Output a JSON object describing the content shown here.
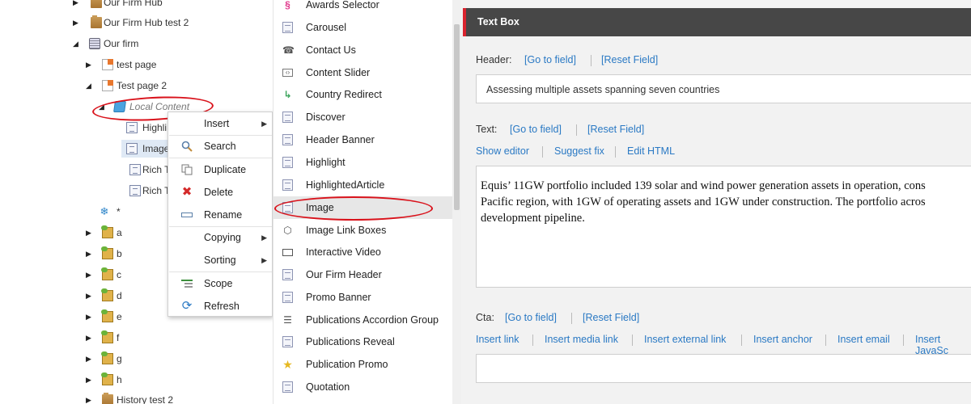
{
  "tree": {
    "nodes": [
      {
        "label": "Our Firm Hub",
        "icon": "folder-icon"
      },
      {
        "label": "Our Firm Hub test 2",
        "icon": "folder-icon"
      },
      {
        "label": "Our firm",
        "icon": "database-icon"
      },
      {
        "label": "test page",
        "icon": "page-icon"
      },
      {
        "label": "Test page 2",
        "icon": "page-icon"
      },
      {
        "label": "Local Content",
        "icon": "local-content-icon"
      },
      {
        "label": "Highli",
        "icon": "document-icon"
      },
      {
        "label": "Image",
        "icon": "document-icon"
      },
      {
        "label": "Rich T",
        "icon": "document-icon"
      },
      {
        "label": "Rich T",
        "icon": "document-icon"
      },
      {
        "label": "*",
        "icon": "snowflake-icon"
      },
      {
        "label": "a",
        "icon": "box-icon"
      },
      {
        "label": "b",
        "icon": "box-icon"
      },
      {
        "label": "c",
        "icon": "box-icon"
      },
      {
        "label": "d",
        "icon": "box-icon"
      },
      {
        "label": "e",
        "icon": "box-icon"
      },
      {
        "label": "f",
        "icon": "box-icon"
      },
      {
        "label": "g",
        "icon": "box-icon"
      },
      {
        "label": "h",
        "icon": "box-icon"
      },
      {
        "label": "History test 2",
        "icon": "folder-icon"
      }
    ]
  },
  "context_menu": {
    "items": [
      {
        "label": "Insert",
        "icon": "",
        "submenu": true
      },
      {
        "label": "Search",
        "icon": "search-icon",
        "submenu": false
      },
      {
        "label": "Duplicate",
        "icon": "duplicate-icon",
        "submenu": false
      },
      {
        "label": "Delete",
        "icon": "delete-icon",
        "submenu": false
      },
      {
        "label": "Rename",
        "icon": "rename-icon",
        "submenu": false
      },
      {
        "label": "Copying",
        "icon": "",
        "submenu": true
      },
      {
        "label": "Sorting",
        "icon": "",
        "submenu": true
      },
      {
        "label": "Scope",
        "icon": "scope-icon",
        "submenu": false
      },
      {
        "label": "Refresh",
        "icon": "refresh-icon",
        "submenu": false
      }
    ]
  },
  "insert_options": {
    "items": [
      {
        "label": "Awards Selector",
        "icon": "awards-icon"
      },
      {
        "label": "Carousel",
        "icon": "template-icon"
      },
      {
        "label": "Contact Us",
        "icon": "phone-icon"
      },
      {
        "label": "Content Slider",
        "icon": "slider-icon"
      },
      {
        "label": "Country Redirect",
        "icon": "redirect-icon"
      },
      {
        "label": "Discover",
        "icon": "template-icon"
      },
      {
        "label": "Header Banner",
        "icon": "template-icon"
      },
      {
        "label": "Highlight",
        "icon": "template-icon"
      },
      {
        "label": "HighlightedArticle",
        "icon": "template-icon"
      },
      {
        "label": "Image",
        "icon": "template-icon"
      },
      {
        "label": "Image Link Boxes",
        "icon": "cube-icon"
      },
      {
        "label": "Interactive Video",
        "icon": "video-icon"
      },
      {
        "label": "Our Firm Header",
        "icon": "template-icon"
      },
      {
        "label": "Promo Banner",
        "icon": "template-icon"
      },
      {
        "label": "Publications Accordion Group",
        "icon": "accordion-icon"
      },
      {
        "label": "Publications Reveal",
        "icon": "template-icon"
      },
      {
        "label": "Publication Promo",
        "icon": "star-icon"
      },
      {
        "label": "Quotation",
        "icon": "template-icon"
      }
    ],
    "highlighted": "Image"
  },
  "editor": {
    "section_title": "Text Box",
    "header_field": {
      "label": "Header:",
      "go_to_field": "[Go to field]",
      "reset_field": "[Reset Field]",
      "value": "Assessing multiple assets spanning seven countries"
    },
    "text_field": {
      "label": "Text:",
      "go_to_field": "[Go to field]",
      "reset_field": "[Reset Field]",
      "show_editor": "Show editor",
      "suggest_fix": "Suggest fix",
      "edit_html": "Edit HTML",
      "value_lines": [
        "Equis’ 11GW portfolio included 139 solar and wind power generation assets in operation, cons",
        "Pacific region, with 1GW of operating assets and 1GW under construction. The portfolio acros",
        "development pipeline."
      ]
    },
    "cta_field": {
      "label": "Cta:",
      "go_to_field": "[Go to field]",
      "reset_field": "[Reset Field]",
      "insert_link": "Insert link",
      "insert_media_link": "Insert media link",
      "insert_external_link": "Insert external link",
      "insert_anchor": "Insert anchor",
      "insert_email": "Insert email",
      "insert_javascript": "Insert JavaSc",
      "value": ""
    }
  },
  "colors": {
    "section_bar": "#474747",
    "accent_red": "#d9232e",
    "link_blue": "#2a79c4",
    "annotation_red": "#d9121b",
    "highlight_row": "#e7e7e7"
  }
}
